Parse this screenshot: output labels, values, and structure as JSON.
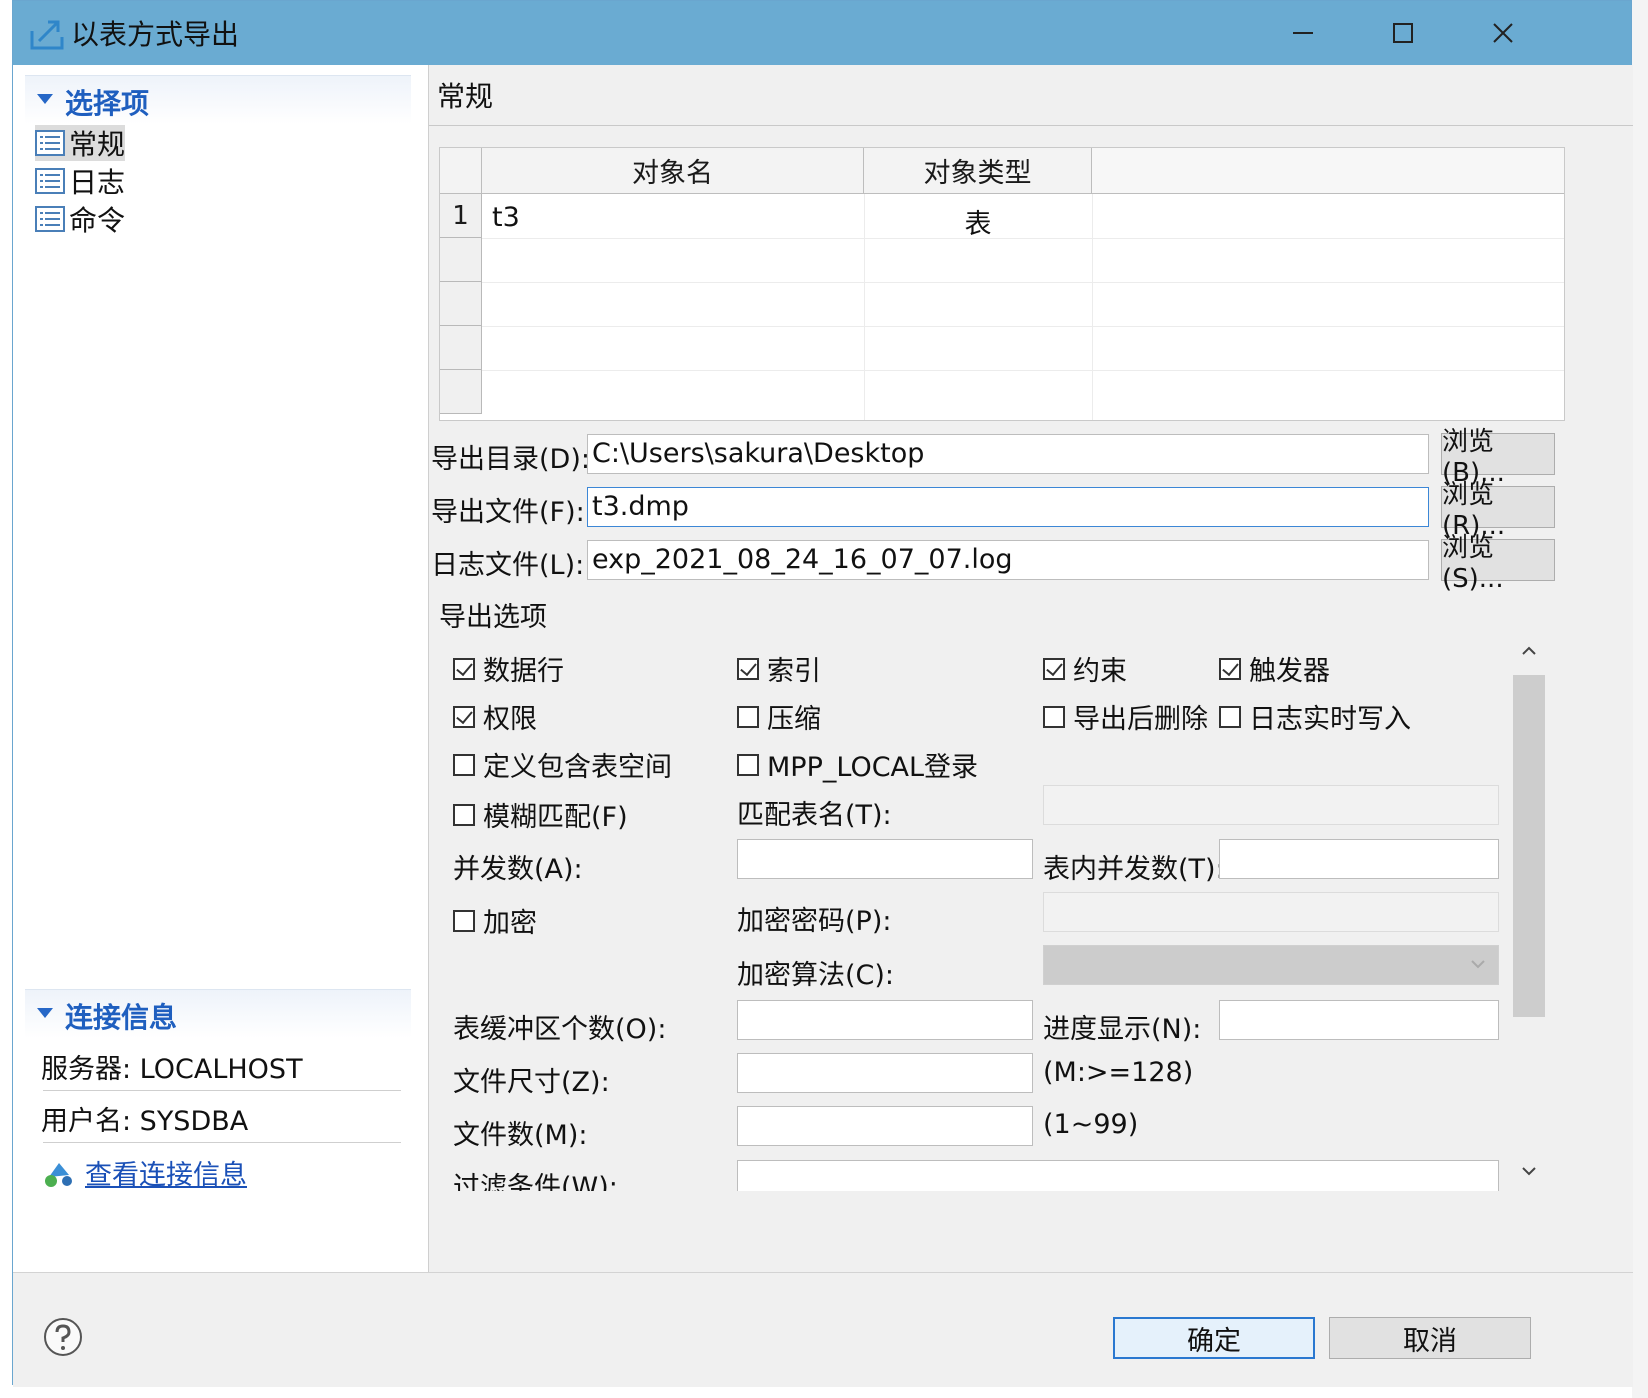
{
  "window": {
    "title": "以表方式导出"
  },
  "left": {
    "options_header": "选择项",
    "nav_items": [
      "常规",
      "日志",
      "命令"
    ],
    "connection_header": "连接信息",
    "server": "服务器: LOCALHOST",
    "user": "用户名: SYSDBA",
    "view_link": "查看连接信息"
  },
  "page": {
    "title": "常规"
  },
  "grid": {
    "columns": [
      "对象名",
      "对象类型"
    ],
    "rows": [
      {
        "num": "1",
        "name": "t3",
        "type": "表"
      }
    ]
  },
  "paths": {
    "dir_label": "导出目录(D):",
    "dir_value": "C:\\Users\\sakura\\Desktop",
    "dir_browse": "浏览(B)...",
    "file_label": "导出文件(F):",
    "file_value": "t3.dmp",
    "file_browse": "浏览(R)...",
    "log_label": "日志文件(L):",
    "log_value": "exp_2021_08_24_16_07_07.log",
    "log_browse": "浏览(S)..."
  },
  "options": {
    "group_label": "导出选项",
    "checkboxes": [
      {
        "label": "数据行",
        "checked": true
      },
      {
        "label": "索引",
        "checked": true
      },
      {
        "label": "约束",
        "checked": true
      },
      {
        "label": "触发器",
        "checked": true
      },
      {
        "label": "权限",
        "checked": true
      },
      {
        "label": "压缩",
        "checked": false
      },
      {
        "label": "导出后删除",
        "checked": false
      },
      {
        "label": "日志实时写入",
        "checked": false
      },
      {
        "label": "定义包含表空间",
        "checked": false
      },
      {
        "label": "MPP_LOCAL登录",
        "checked": false
      },
      {
        "label": "模糊匹配(F)",
        "checked": false
      },
      {
        "label": "加密",
        "checked": false
      }
    ],
    "match_table_label": "匹配表名(T):",
    "parallel_label": "并发数(A):",
    "table_parallel_label": "表内并发数(T):",
    "encrypt_pwd_label": "加密密码(P):",
    "encrypt_algo_label": "加密算法(C):",
    "buffer_label": "表缓冲区个数(O):",
    "progress_label": "进度显示(N):",
    "file_size_label": "文件尺寸(Z):",
    "file_size_hint": "(M:>=128)",
    "file_count_label": "文件数(M):",
    "file_count_hint": "(1~99)",
    "filter_label": "过滤条件(W):"
  },
  "footer": {
    "ok": "确定",
    "cancel": "取消"
  },
  "colors": {
    "titlebar": "#6aabd2",
    "section_header_text": "#1f5fbf",
    "link": "#1a50b7",
    "focus_border": "#3c87d6"
  }
}
